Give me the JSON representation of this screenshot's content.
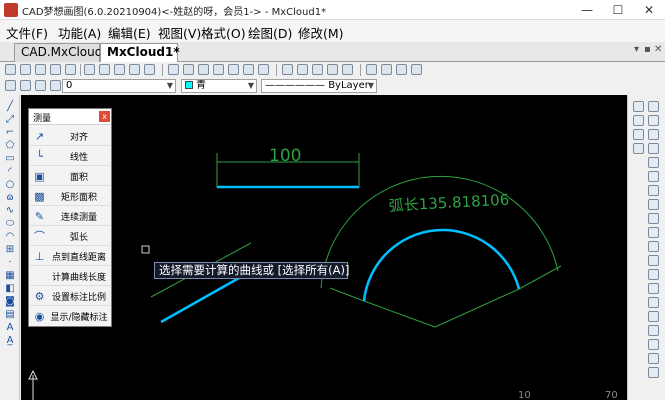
{
  "window": {
    "title": "CAD梦想画图(6.0.20210904)<-姓赵的呀，会员1-> - MxCloud1*",
    "minimize_glyph": "—",
    "maximize_glyph": "☐",
    "close_glyph": "✕"
  },
  "menubar": {
    "items": [
      "文件(F)",
      "功能(A)",
      "编辑(E)",
      "视图(V)",
      "格式(O)",
      "绘图(D)",
      "修改(M)"
    ]
  },
  "tabs": {
    "items": [
      {
        "label": "CAD.MxCloud",
        "active": false
      },
      {
        "label": "MxCloud1*",
        "active": true
      }
    ],
    "controls": [
      "▾",
      "▪",
      "✕"
    ]
  },
  "properties": {
    "layer": "0",
    "color_label": "青",
    "color_hex": "#00ffff",
    "linetype": "ByLayer"
  },
  "measure_panel": {
    "title": "测量",
    "close_label": "x",
    "items": [
      {
        "label": "对齐",
        "icon": "align-dimension-icon"
      },
      {
        "label": "线性",
        "icon": "linear-dimension-icon"
      },
      {
        "label": "面积",
        "icon": "area-icon"
      },
      {
        "label": "矩形面积",
        "icon": "rect-area-icon"
      },
      {
        "label": "连续测量",
        "icon": "continuous-measure-icon"
      },
      {
        "label": "弧长",
        "icon": "arc-length-icon"
      },
      {
        "label": "点到直线距离",
        "icon": "point-line-distance-icon"
      },
      {
        "label": "计算曲线长度",
        "icon": "curve-length-icon"
      },
      {
        "label": "设置标注比例",
        "icon": "dimension-scale-icon"
      },
      {
        "label": "显示/隐藏标注",
        "icon": "toggle-dimension-icon"
      }
    ]
  },
  "drawing": {
    "linear_dim_text": "100",
    "arc_dim_text": "弧长135.818106",
    "axis_label_10": "10",
    "axis_label_70": "70",
    "dim_color": "#2ea043",
    "entity_color": "#00bfff"
  },
  "command_prompt": "选择需要计算的曲线或 [选择所有(A)]"
}
